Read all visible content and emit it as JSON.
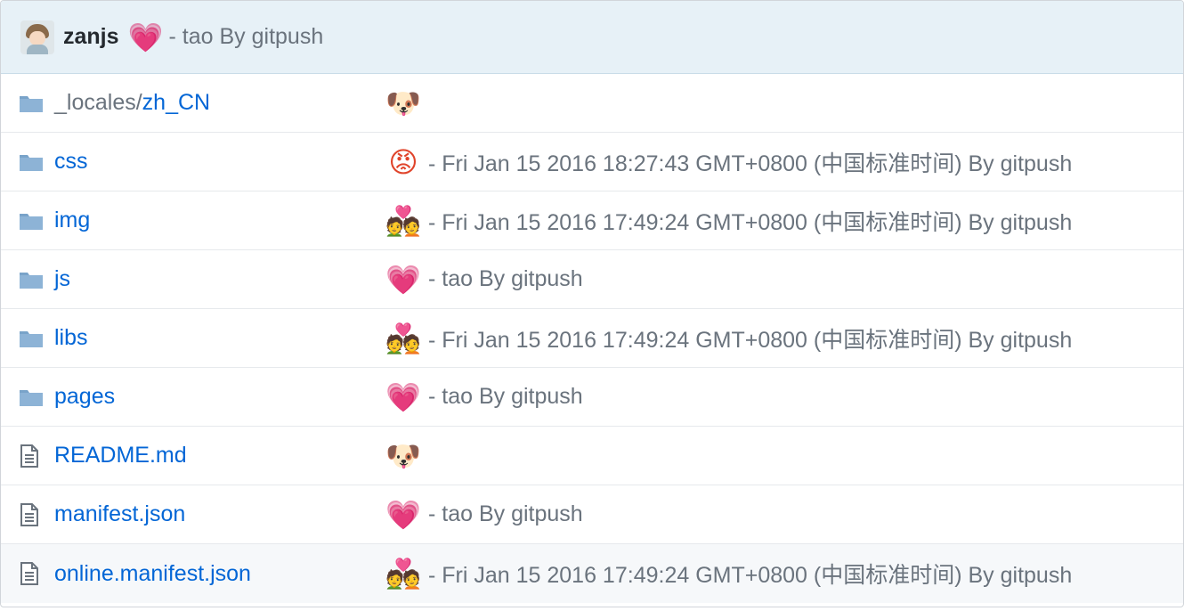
{
  "header": {
    "author": "zanjs",
    "emoji": "💗",
    "emoji_name": "heart-icon",
    "message": "- tao By gitpush"
  },
  "files": [
    {
      "type": "folder",
      "icon": "folder-icon",
      "prefix": "_locales/",
      "name": "zh_CN",
      "emoji": "🐶",
      "emoji_name": "dog-icon",
      "message": ""
    },
    {
      "type": "folder",
      "icon": "folder-icon",
      "prefix": "",
      "name": "css",
      "emoji": "😡",
      "emoji_name": "angry-face-icon",
      "message": "- Fri Jan 15 2016 18:27:43 GMT+0800 (中国标准时间) By gitpush"
    },
    {
      "type": "folder",
      "icon": "folder-icon",
      "prefix": "",
      "name": "img",
      "emoji": "💑",
      "emoji_name": "couple-icon",
      "message": "- Fri Jan 15 2016 17:49:24 GMT+0800 (中国标准时间) By gitpush"
    },
    {
      "type": "folder",
      "icon": "folder-icon",
      "prefix": "",
      "name": "js",
      "emoji": "💗",
      "emoji_name": "heart-icon",
      "message": "- tao By gitpush"
    },
    {
      "type": "folder",
      "icon": "folder-icon",
      "prefix": "",
      "name": "libs",
      "emoji": "💑",
      "emoji_name": "couple-icon",
      "message": "- Fri Jan 15 2016 17:49:24 GMT+0800 (中国标准时间) By gitpush"
    },
    {
      "type": "folder",
      "icon": "folder-icon",
      "prefix": "",
      "name": "pages",
      "emoji": "💗",
      "emoji_name": "heart-icon",
      "message": "- tao By gitpush"
    },
    {
      "type": "file",
      "icon": "file-icon",
      "prefix": "",
      "name": "README.md",
      "emoji": "🐶",
      "emoji_name": "dog-icon",
      "message": ""
    },
    {
      "type": "file",
      "icon": "file-icon",
      "prefix": "",
      "name": "manifest.json",
      "emoji": "💗",
      "emoji_name": "heart-icon",
      "message": "- tao By gitpush"
    },
    {
      "type": "file",
      "icon": "file-icon",
      "prefix": "",
      "name": "online.manifest.json",
      "emoji": "💑",
      "emoji_name": "couple-icon",
      "message": "- Fri Jan 15 2016 17:49:24 GMT+0800 (中国标准时间) By gitpush"
    }
  ],
  "colors": {
    "link": "#0366d6",
    "muted": "#6a737d",
    "header_bg": "#e7f1f7",
    "folder": "#79a3c9"
  }
}
